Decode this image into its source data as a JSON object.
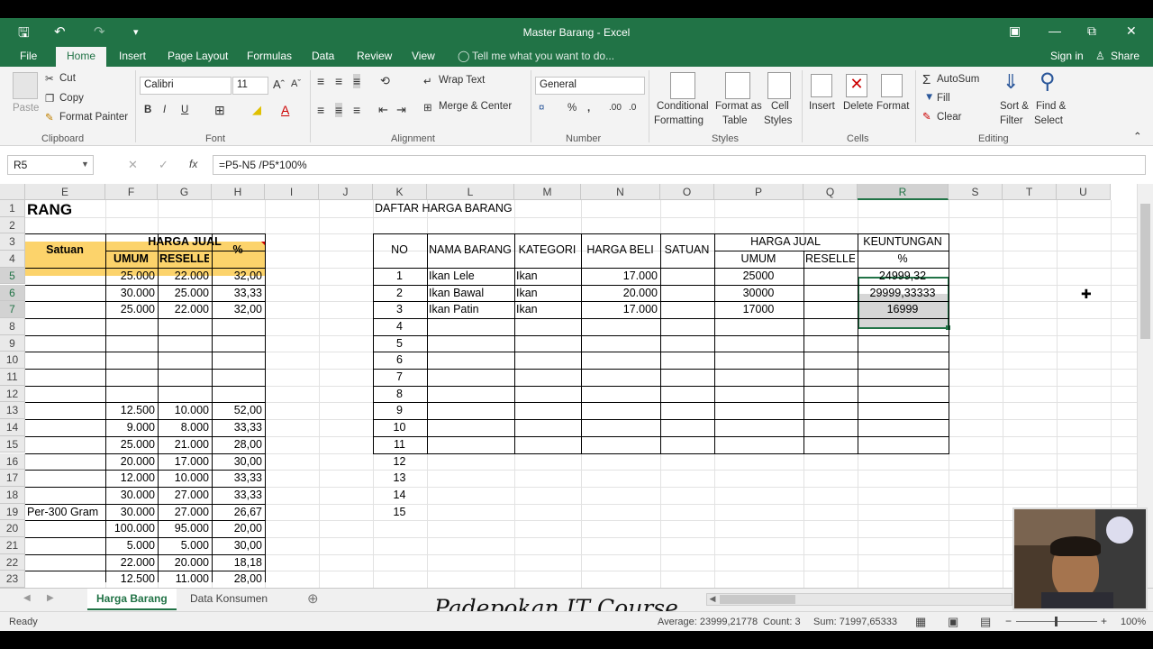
{
  "window": {
    "title": "Master Barang - Excel",
    "sign_in": "Sign in",
    "share": "Share"
  },
  "tabs": [
    "File",
    "Home",
    "Insert",
    "Page Layout",
    "Formulas",
    "Data",
    "Review",
    "View"
  ],
  "tell_me": "Tell me what you want to do...",
  "ribbon": {
    "clipboard": {
      "paste": "Paste",
      "cut": "Cut",
      "copy": "Copy",
      "format_painter": "Format Painter",
      "group": "Clipboard"
    },
    "font": {
      "name": "Calibri",
      "size": "11",
      "bold": "B",
      "italic": "I",
      "underline": "U",
      "group": "Font"
    },
    "alignment": {
      "wrap_text": "Wrap Text",
      "merge_center": "Merge & Center",
      "group": "Alignment"
    },
    "number": {
      "format": "General",
      "percent": "%",
      "comma": ",",
      "group": "Number"
    },
    "styles": {
      "conditional_1": "Conditional",
      "conditional_2": "Formatting",
      "format_table_1": "Format as",
      "format_table_2": "Table",
      "cell_styles_1": "Cell",
      "cell_styles_2": "Styles",
      "group": "Styles"
    },
    "cells": {
      "insert": "Insert",
      "delete": "Delete",
      "format": "Format",
      "group": "Cells"
    },
    "editing": {
      "autosum": "AutoSum",
      "fill": "Fill",
      "clear": "Clear",
      "sort_1": "Sort &",
      "sort_2": "Filter",
      "find_1": "Find &",
      "find_2": "Select",
      "group": "Editing"
    }
  },
  "formula_bar": {
    "name_box": "R5",
    "fx": "fx",
    "formula": "=P5-N5 /P5*100%"
  },
  "columns": [
    "E",
    "F",
    "G",
    "H",
    "I",
    "J",
    "K",
    "L",
    "M",
    "N",
    "O",
    "P",
    "Q",
    "R",
    "S",
    "T",
    "U"
  ],
  "rows": [
    "1",
    "2",
    "3",
    "4",
    "5",
    "6",
    "7",
    "8",
    "9",
    "10",
    "11",
    "12",
    "13",
    "14",
    "15",
    "16",
    "17",
    "18",
    "19",
    "20",
    "21",
    "22",
    "23"
  ],
  "left_table": {
    "title_fragment": "RANG",
    "satuan": "Satuan",
    "harga_jual": "HARGA JUAL",
    "umum": "UMUM",
    "reseller": "RESELLER",
    "percent": "%",
    "rows": [
      {
        "r": 5,
        "e": "",
        "f": "25.000",
        "g": "22.000",
        "h": "32,00"
      },
      {
        "r": 6,
        "e": "",
        "f": "30.000",
        "g": "25.000",
        "h": "33,33"
      },
      {
        "r": 7,
        "e": "",
        "f": "25.000",
        "g": "22.000",
        "h": "32,00"
      },
      {
        "r": 13,
        "e": "",
        "f": "12.500",
        "g": "10.000",
        "h": "52,00"
      },
      {
        "r": 14,
        "e": "",
        "f": "9.000",
        "g": "8.000",
        "h": "33,33"
      },
      {
        "r": 15,
        "e": "",
        "f": "25.000",
        "g": "21.000",
        "h": "28,00"
      },
      {
        "r": 16,
        "e": "",
        "f": "20.000",
        "g": "17.000",
        "h": "30,00"
      },
      {
        "r": 17,
        "e": "",
        "f": "12.000",
        "g": "10.000",
        "h": "33,33"
      },
      {
        "r": 18,
        "e": "",
        "f": "30.000",
        "g": "27.000",
        "h": "33,33"
      },
      {
        "r": 19,
        "e": "Per-300 Gram",
        "f": "30.000",
        "g": "27.000",
        "h": "26,67"
      },
      {
        "r": 20,
        "e": "",
        "f": "100.000",
        "g": "95.000",
        "h": "20,00"
      },
      {
        "r": 21,
        "e": "",
        "f": "5.000",
        "g": "5.000",
        "h": "30,00"
      },
      {
        "r": 22,
        "e": "",
        "f": "22.000",
        "g": "20.000",
        "h": "18,18"
      },
      {
        "r": 23,
        "e": "",
        "f": "12.500",
        "g": "11.000",
        "h": "28,00"
      }
    ]
  },
  "right_table": {
    "title": "DAFTAR HARGA BARANG",
    "headers": {
      "no": "NO",
      "nama": "NAMA BARANG",
      "kategori": "KATEGORI",
      "harga_beli": "HARGA BELI",
      "satuan": "SATUAN",
      "harga_jual": "HARGA JUAL",
      "umum": "UMUM",
      "reseller": "RESELLER",
      "keuntungan": "KEUNTUNGAN",
      "percent": "%"
    },
    "rows": [
      {
        "no": "1",
        "nama": "Ikan Lele",
        "kategori": "Ikan",
        "beli": "17.000",
        "umum": "25000",
        "untung": "24999,32"
      },
      {
        "no": "2",
        "nama": "Ikan Bawal",
        "kategori": "Ikan",
        "beli": "20.000",
        "umum": "30000",
        "untung": "29999,33333"
      },
      {
        "no": "3",
        "nama": "Ikan Patin",
        "kategori": "Ikan",
        "beli": "17.000",
        "umum": "17000",
        "untung": "16999"
      },
      {
        "no": "4"
      },
      {
        "no": "5"
      },
      {
        "no": "6"
      },
      {
        "no": "7"
      },
      {
        "no": "8"
      },
      {
        "no": "9"
      },
      {
        "no": "10"
      },
      {
        "no": "11"
      },
      {
        "no": "12"
      },
      {
        "no": "13"
      },
      {
        "no": "14"
      },
      {
        "no": "15"
      }
    ]
  },
  "sheets": [
    "Harga Barang",
    "Data Konsumen"
  ],
  "watermark": "Padepokan IT Course",
  "status": {
    "ready": "Ready",
    "average": "Average: 23999,21778",
    "count": "Count: 3",
    "sum": "Sum: 71997,65333",
    "zoom": "100%"
  }
}
